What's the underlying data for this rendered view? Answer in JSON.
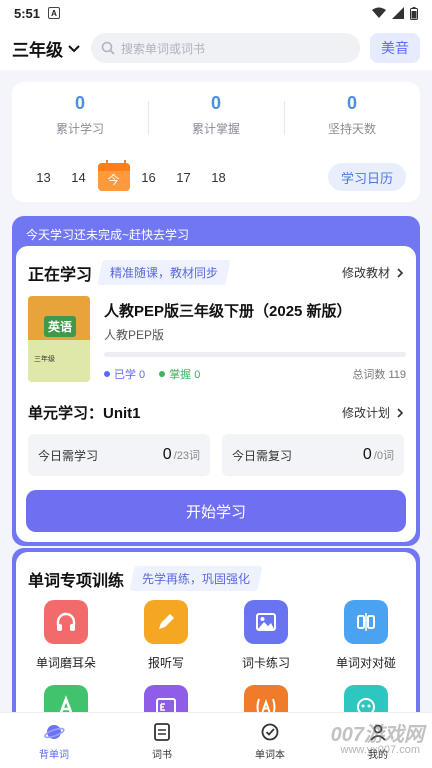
{
  "status_bar": {
    "time": "5:51",
    "notification_badge": "A"
  },
  "header": {
    "grade": "三年级",
    "search_placeholder": "搜索单词或词书",
    "accent_button": "美音"
  },
  "stats": {
    "items": [
      {
        "value": "0",
        "label": "累计学习"
      },
      {
        "value": "0",
        "label": "累计掌握"
      },
      {
        "value": "0",
        "label": "坚持天数"
      }
    ],
    "dates": [
      "13",
      "14",
      "今",
      "16",
      "17",
      "18"
    ],
    "calendar_button": "学习日历"
  },
  "study": {
    "banner": "今天学习还未完成~赶快去学习",
    "title": "正在学习",
    "note": "精准随课，教材同步",
    "edit_book": "修改教材",
    "book": {
      "cover_word": "英语",
      "cover_grade": "三年级",
      "title": "人教PEP版三年级下册（2025 新版）",
      "publisher": "人教PEP版",
      "progress_fraction": 0,
      "learned": "已学 0",
      "mastered": "掌握 0",
      "total": "总词数 119"
    },
    "unit": "单元学习：Unit1",
    "edit_plan": "修改计划",
    "today_learn_label": "今日需学习",
    "today_learn_value": "0",
    "today_learn_unit": "/23词",
    "today_review_label": "今日需复习",
    "today_review_value": "0",
    "today_review_unit": "/0词",
    "start_button": "开始学习"
  },
  "training": {
    "title": "单词专项训练",
    "note": "先学再练，巩固强化",
    "tiles": [
      {
        "label": "单词磨耳朵",
        "icon": "headphones-icon",
        "color": "#f26a6a"
      },
      {
        "label": "报听写",
        "icon": "pencil-icon",
        "color": "#f5a623"
      },
      {
        "label": "词卡练习",
        "icon": "image-icon",
        "color": "#6b74f0"
      },
      {
        "label": "单词对对碰",
        "icon": "match-icon",
        "color": "#4aa3f0"
      }
    ],
    "second_row_colors": [
      "#3fc46d",
      "#8f5ee8",
      "#f07b2b",
      "#2ec7c0"
    ]
  },
  "bottom_nav": [
    {
      "label": "背单词",
      "icon": "planet-icon",
      "active": true
    },
    {
      "label": "词书",
      "icon": "book-icon",
      "active": false
    },
    {
      "label": "单词本",
      "icon": "notebook-icon",
      "active": false
    },
    {
      "label": "我的",
      "icon": "user-icon",
      "active": false
    }
  ],
  "watermark": {
    "main": "007游戏网",
    "sub": "www.yx007.com"
  },
  "colors": {
    "accent": "#6f6ff2",
    "stat_blue": "#4a90e2",
    "today_orange": "#ff9a3c"
  }
}
